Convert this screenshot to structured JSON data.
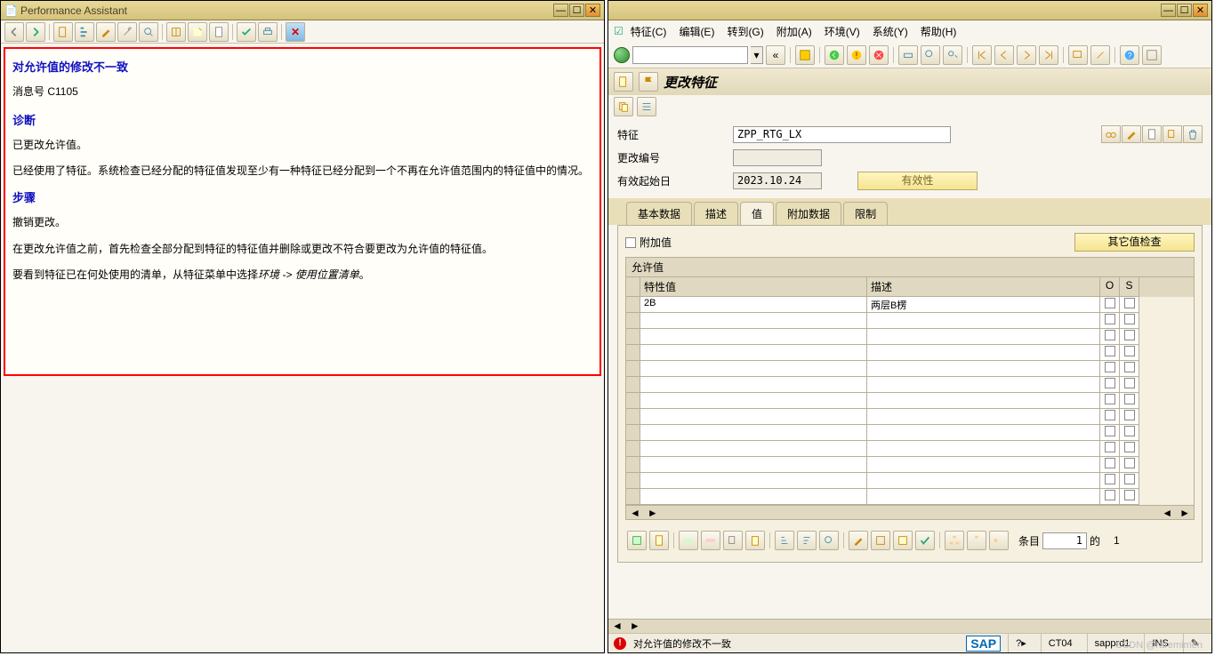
{
  "left": {
    "title": "Performance Assistant",
    "h1": "对允许值的修改不一致",
    "msgno": "消息号 C1105",
    "h2a": "诊断",
    "p1": "已更改允许值。",
    "p2": "已经使用了特征。系统检查已经分配的特征值发现至少有一种特征已经分配到一个不再在允许值范围内的特征值中的情况。",
    "h2b": "步骤",
    "p3": "撤销更改。",
    "p4": "在更改允许值之前，首先检查全部分配到特征的特征值并删除或更改不符合要更改为允许值的特征值。",
    "p5a": "要看到特征已在何处使用的清单，从特征菜单中选择",
    "p5b": "环境 -> 使用位置清单",
    "p5c": "。"
  },
  "right": {
    "menus": [
      "特征(C)",
      "编辑(E)",
      "转到(G)",
      "附加(A)",
      "环境(V)",
      "系统(Y)",
      "帮助(H)"
    ],
    "app_title": "更改特征",
    "field_char_label": "特征",
    "field_char_value": "ZPP_RTG_LX",
    "field_chgno_label": "更改编号",
    "field_date_label": "有效起始日",
    "field_date_value": "2023.10.24",
    "validity_btn": "有效性",
    "tabs": [
      "基本数据",
      "描述",
      "值",
      "附加数据",
      "限制"
    ],
    "active_tab": 2,
    "addval_label": "附加值",
    "other_check": "其它值检查",
    "table_title": "允许值",
    "col_val": "特性值",
    "col_desc": "描述",
    "col_o": "O",
    "col_s": "S",
    "rows": [
      {
        "v": "2B",
        "d": "两层B楞"
      }
    ],
    "entry_label": "条目",
    "entry_val": "1",
    "entry_of": "的",
    "entry_total": "1",
    "status_err": "对允许值的修改不一致",
    "tcode": "CT04",
    "system": "sapprd1",
    "ins": "INS",
    "watermark": "CSDN @raremimen"
  }
}
